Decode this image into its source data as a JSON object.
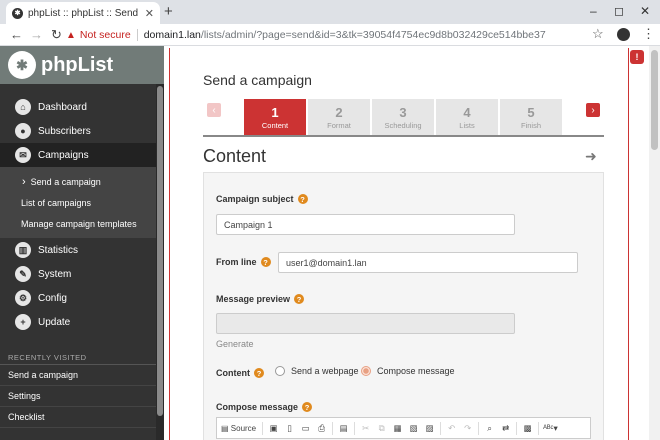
{
  "browser": {
    "tab_title": "phpList :: phpList :: Send a",
    "not_secure": "Not secure",
    "url_host": "domain1.lan",
    "url_rest": "/lists/admin/?page=send&id=3&tk=39054f4754ec9d8b032429ce514bbe37",
    "icons": [
      "back-icon",
      "forward-icon",
      "reload-icon",
      "star-icon",
      "profile-icon",
      "menu-icon"
    ]
  },
  "sidebar": {
    "brand": "phpList",
    "menu": [
      {
        "label": "Dashboard",
        "icon": "home-icon"
      },
      {
        "label": "Subscribers",
        "icon": "user-icon"
      },
      {
        "label": "Campaigns",
        "icon": "envelope-icon"
      }
    ],
    "submenu": [
      "Send a campaign",
      "List of campaigns",
      "Manage campaign templates"
    ],
    "menu2": [
      {
        "label": "Statistics",
        "icon": "chart-icon"
      },
      {
        "label": "System",
        "icon": "wrench-icon"
      },
      {
        "label": "Config",
        "icon": "gear-icon"
      },
      {
        "label": "Update",
        "icon": "plus-icon"
      }
    ],
    "recent_label": "RECENTLY VISITED",
    "recent": [
      "Send a campaign",
      "Settings",
      "Checklist"
    ]
  },
  "main": {
    "page_title": "Send a campaign",
    "steps": [
      {
        "num": "1",
        "label": "Content"
      },
      {
        "num": "2",
        "label": "Format"
      },
      {
        "num": "3",
        "label": "Scheduling"
      },
      {
        "num": "4",
        "label": "Lists"
      },
      {
        "num": "5",
        "label": "Finish"
      }
    ],
    "section_title": "Content",
    "form": {
      "subject_label": "Campaign subject",
      "subject_value": "Campaign 1",
      "from_label": "From line",
      "from_value": "user1@domain1.lan",
      "preview_label": "Message preview",
      "preview_value": "",
      "generate": "Generate",
      "content_label": "Content",
      "content_options": [
        "Send a webpage",
        "Compose message"
      ],
      "compose_label": "Compose message",
      "toolbar_source": "Source"
    }
  },
  "colors": {
    "accent": "#cc3333",
    "sidebar": "#333333",
    "brand_bar": "#717b78",
    "help": "#e08a1e"
  }
}
